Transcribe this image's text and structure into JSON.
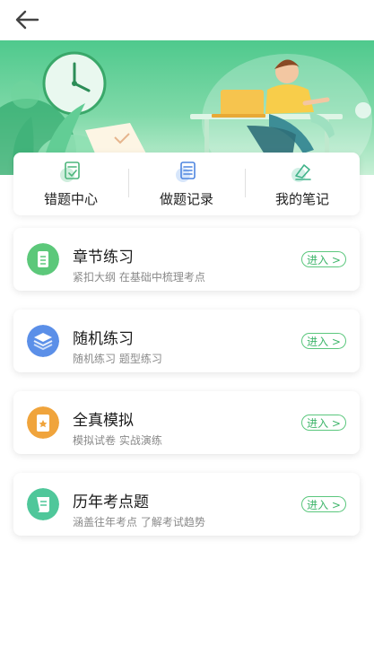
{
  "header": {
    "back_icon": "arrow-left-icon"
  },
  "quick_links": [
    {
      "label": "错题中心",
      "icon": "checklist-icon"
    },
    {
      "label": "做题记录",
      "icon": "list-icon"
    },
    {
      "label": "我的笔记",
      "icon": "eraser-pencil-icon"
    }
  ],
  "cards": [
    {
      "title": "章节练习",
      "subtitle": "紧扣大纲 在基础中梳理考点",
      "button": "进入 >",
      "icon": "document-icon",
      "color": "#5cc87a"
    },
    {
      "title": "随机练习",
      "subtitle": "随机练习 题型练习",
      "button": "进入 >",
      "icon": "layers-icon",
      "color": "#5b8fe8"
    },
    {
      "title": "全真模拟",
      "subtitle": "模拟试卷 实战演练",
      "button": "进入 >",
      "icon": "exam-icon",
      "color": "#f0a43c"
    },
    {
      "title": "历年考点题",
      "subtitle": "涵盖往年考点 了解考试趋势",
      "button": "进入 >",
      "icon": "scroll-icon",
      "color": "#4fc79a"
    }
  ],
  "colors": {
    "accent": "#3eb56a",
    "banner": "#4fc98d"
  }
}
